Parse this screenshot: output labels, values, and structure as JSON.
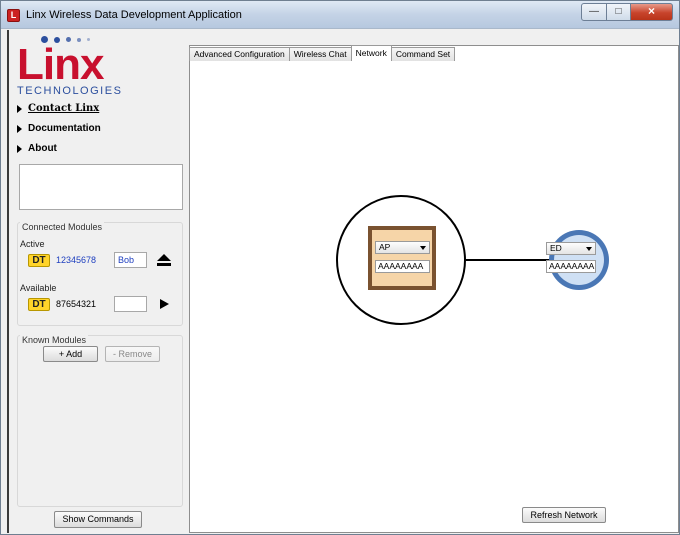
{
  "window": {
    "title": "Linx Wireless Data Development Application"
  },
  "logo": {
    "word": "Linx",
    "sub": "TECHNOLOGIES"
  },
  "nav": [
    {
      "label": "Contact Linx"
    },
    {
      "label": "Documentation"
    },
    {
      "label": "About"
    }
  ],
  "connected_modules": {
    "title": "Connected Modules",
    "active_label": "Active",
    "active": {
      "type": "DT",
      "id": "12345678",
      "name": "Bob"
    },
    "available_label": "Available",
    "available": {
      "type": "DT",
      "id": "87654321",
      "name": ""
    }
  },
  "known_modules": {
    "title": "Known Modules",
    "add_label": "+ Add",
    "remove_label": "- Remove"
  },
  "show_commands_label": "Show Commands",
  "tabs": [
    {
      "label": "Advanced Configuration",
      "active": false
    },
    {
      "label": "Wireless Chat",
      "active": false
    },
    {
      "label": "Network",
      "active": true
    },
    {
      "label": "Command Set",
      "active": false
    }
  ],
  "network": {
    "ap_node": {
      "role": "AP",
      "address": "AAAAAAAA"
    },
    "ed_node": {
      "role": "ED",
      "address": "AAAAAAAA"
    },
    "refresh_label": "Refresh Network"
  },
  "colors": {
    "logo_red": "#c8102e",
    "logo_blue": "#2c4f9e",
    "badge_yellow": "#ffd42a",
    "ap_frame": "#7a5230",
    "ap_fill": "#f6d5a8",
    "ed_ring": "#4a77b5",
    "ed_fill": "#cfe0f4"
  }
}
